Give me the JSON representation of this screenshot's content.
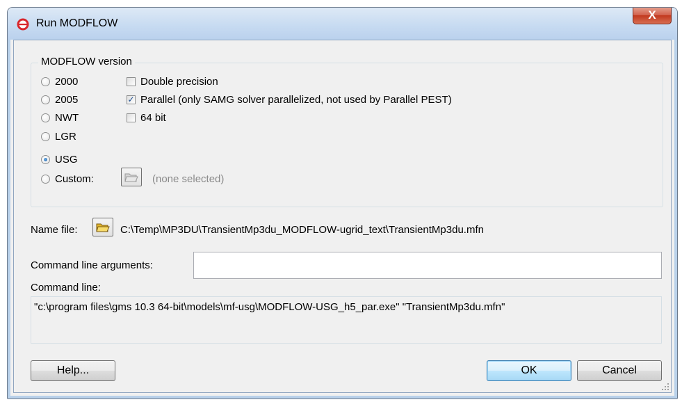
{
  "window": {
    "title": "Run MODFLOW",
    "close_glyph": "X"
  },
  "version_group": {
    "legend": "MODFLOW version",
    "options": [
      {
        "label": "2000",
        "selected": false
      },
      {
        "label": "2005",
        "selected": false
      },
      {
        "label": "NWT",
        "selected": false
      },
      {
        "label": "LGR",
        "selected": false
      },
      {
        "label": "USG",
        "selected": true
      },
      {
        "label": "Custom:",
        "selected": false
      }
    ],
    "checkboxes": [
      {
        "label": "Double precision",
        "checked": false
      },
      {
        "label": "Parallel (only SAMG solver parallelized, not used by Parallel PEST)",
        "checked": true
      },
      {
        "label": "64 bit",
        "checked": false
      }
    ],
    "custom_path": "(none selected)",
    "custom_browse_icon": "open-folder-icon"
  },
  "name_file": {
    "label": "Name file:",
    "path": "C:\\Temp\\MP3DU\\TransientMp3du_MODFLOW-ugrid_text\\TransientMp3du.mfn",
    "browse_icon": "open-folder-icon"
  },
  "command_args": {
    "label": "Command line arguments:",
    "value": "",
    "placeholder": ""
  },
  "command_line": {
    "label": "Command line:",
    "value": "\"c:\\program files\\gms 10.3 64-bit\\models\\mf-usg\\MODFLOW-USG_h5_par.exe\" \"TransientMp3du.mfn\""
  },
  "buttons": {
    "help": "Help...",
    "ok": "OK",
    "cancel": "Cancel"
  },
  "colors": {
    "accent": "#1d5ca3",
    "close_red": "#c1381e",
    "dialog_bg": "#f0f0f0"
  }
}
